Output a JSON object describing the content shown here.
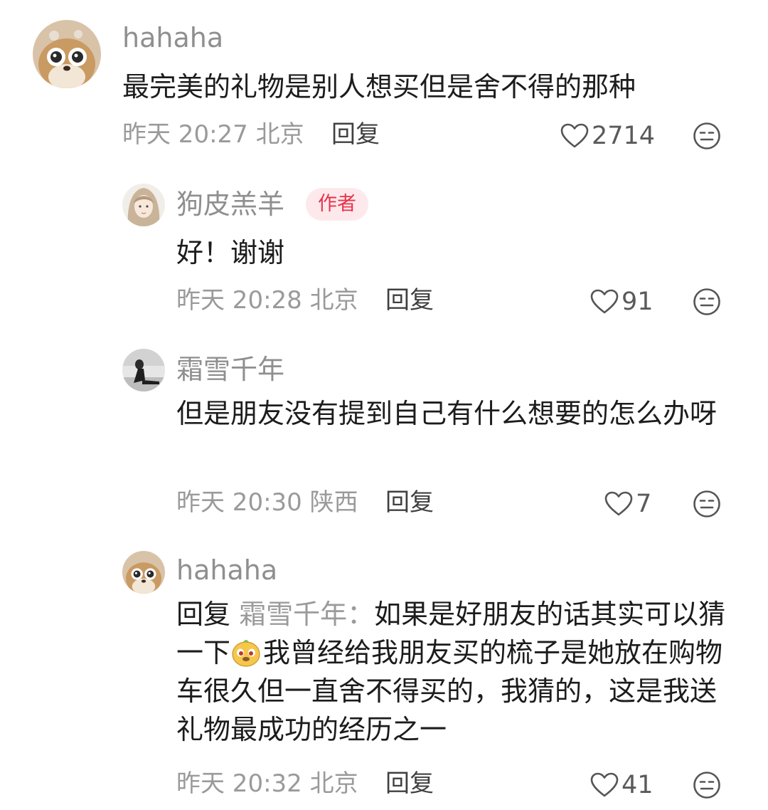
{
  "comments": [
    {
      "username": "hahaha",
      "text": "最完美的礼物是别人想买但是舍不得的那种",
      "time": "昨天 20:27",
      "location": "北京",
      "reply_label": "回复",
      "likes": "2714",
      "avatar": "cartoon-bear-avatar"
    },
    {
      "username": "狗皮羔羊",
      "badge": "作者",
      "text": "好！谢谢",
      "time": "昨天 20:28",
      "location": "北京",
      "reply_label": "回复",
      "likes": "91",
      "avatar": "anime-girl-avatar"
    },
    {
      "username": "霜雪千年",
      "text": "但是朋友没有提到自己有什么想要的怎么办呀",
      "time": "昨天 20:30",
      "location": "陕西",
      "reply_label": "回复",
      "likes": "7",
      "avatar": "person-photo-avatar"
    },
    {
      "username": "hahaha",
      "reply_prefix": "回复",
      "reply_target": "霜雪千年：",
      "text_part1": "如果是好朋友的话其实可以猜一下",
      "emoji": "doge-emoji",
      "text_part2": "我曾经给我朋友买的梳子是她放在购物车很久但一直舍不得买的，我猜的，这是我送礼物最成功的经历之一",
      "time": "昨天 20:32",
      "location": "北京",
      "reply_label": "回复",
      "likes": "41",
      "avatar": "cartoon-bear-avatar"
    }
  ],
  "icons": {
    "like": "heart-outline-icon",
    "dislike": "meh-face-icon"
  },
  "colors": {
    "badge_text": "#e8334a",
    "badge_bg": "#fde9ec",
    "meta_gray": "#9a9a9a"
  }
}
